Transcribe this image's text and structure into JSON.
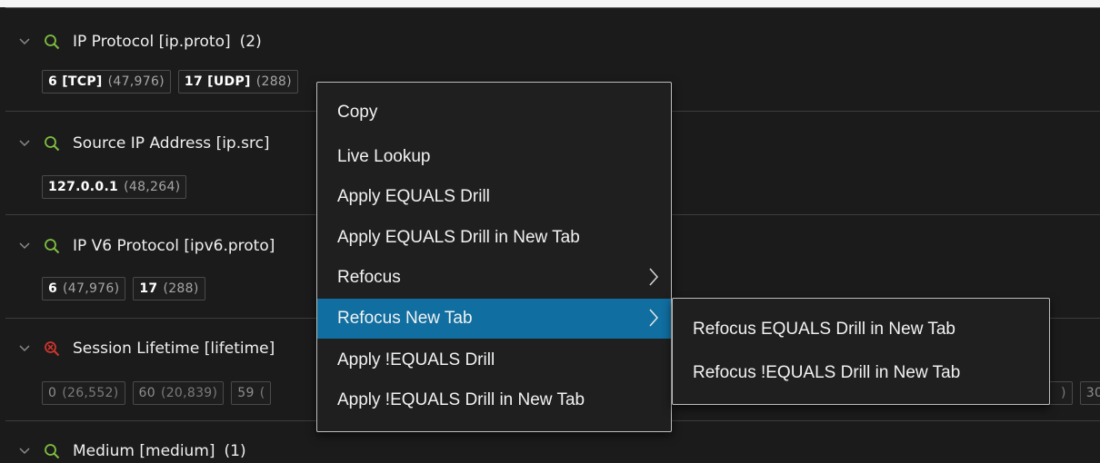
{
  "fields": [
    {
      "title": "IP Protocol [ip.proto]",
      "count": "(2)",
      "status_icon": "search-icon",
      "values": [
        {
          "value": "6 [TCP]",
          "count": "(47,976)"
        },
        {
          "value": "17 [UDP]",
          "count": "(288)"
        }
      ]
    },
    {
      "title": "Source IP Address [ip.src]",
      "count": "",
      "status_icon": "search-icon",
      "values": [
        {
          "value": "127.0.0.1",
          "count": "(48,264)"
        }
      ]
    },
    {
      "title": "IP V6 Protocol [ipv6.proto]",
      "count": "",
      "status_icon": "search-icon",
      "values": [
        {
          "value": "6",
          "count": "(47,976)"
        },
        {
          "value": "17",
          "count": "(288)"
        }
      ]
    },
    {
      "title": "Session Lifetime [lifetime]",
      "count": "",
      "status_icon": "error-icon",
      "values": [
        {
          "value": "0",
          "count": "(26,552)"
        },
        {
          "value": "60",
          "count": "(20,839)"
        },
        {
          "value": "59",
          "count": "("
        }
      ],
      "values_right": [
        "30"
      ]
    },
    {
      "title": "Medium [medium]",
      "count": "(1)",
      "status_icon": "search-icon",
      "values": []
    }
  ],
  "context_menu": {
    "items": [
      {
        "label": "Copy"
      },
      {
        "label": "Live Lookup"
      },
      {
        "label": "Apply EQUALS Drill"
      },
      {
        "label": "Apply EQUALS Drill in New Tab"
      },
      {
        "label": "Refocus",
        "submenu_arrow": true
      },
      {
        "label": "Refocus New Tab",
        "submenu_arrow": true,
        "active": true
      },
      {
        "label": "Apply !EQUALS Drill"
      },
      {
        "label": "Apply !EQUALS Drill in New Tab"
      }
    ]
  },
  "submenu": {
    "items": [
      {
        "label": "Refocus EQUALS Drill in New Tab"
      },
      {
        "label": "Refocus !EQUALS Drill in New Tab"
      }
    ]
  },
  "colors": {
    "background": "#1b1b1c",
    "search_icon": "#7fbf3f",
    "error_icon": "#d0352d",
    "active_menu": "#106ea0"
  }
}
